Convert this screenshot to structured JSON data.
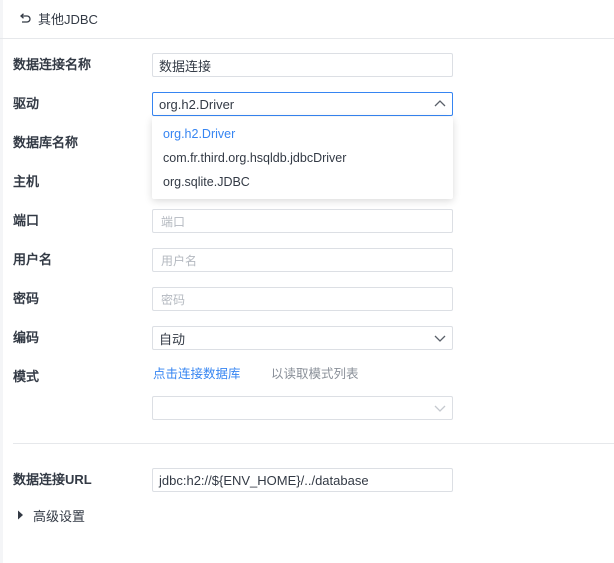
{
  "header": {
    "back_label": "其他JDBC"
  },
  "form": {
    "connection_name": {
      "label": "数据连接名称",
      "value": "数据连接"
    },
    "driver": {
      "label": "驱动",
      "value": "org.h2.Driver",
      "options": [
        "org.h2.Driver",
        "com.fr.third.org.hsqldb.jdbcDriver",
        "org.sqlite.JDBC"
      ]
    },
    "database_name": {
      "label": "数据库名称"
    },
    "host": {
      "label": "主机"
    },
    "port": {
      "label": "端口",
      "placeholder": "端口"
    },
    "username": {
      "label": "用户名",
      "placeholder": "用户名"
    },
    "password": {
      "label": "密码",
      "placeholder": "密码"
    },
    "encoding": {
      "label": "编码",
      "value": "自动"
    },
    "schema": {
      "label": "模式",
      "link": "点击连接数据库",
      "hint": "以读取模式列表"
    },
    "url": {
      "label": "数据连接URL",
      "value": "jdbc:h2://${ENV_HOME}/../database"
    }
  },
  "advanced": {
    "label": "高级设置"
  },
  "colors": {
    "accent": "#3685f2",
    "border": "#dcdfe4",
    "text": "#333a45",
    "placeholder": "#b4b9c0"
  }
}
